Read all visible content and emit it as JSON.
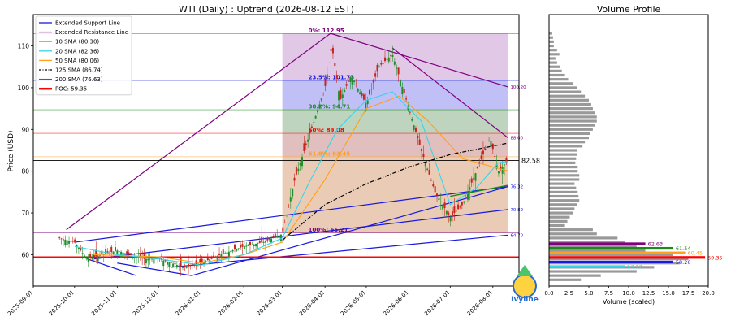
{
  "chart_data": [
    {
      "type": "line",
      "title": "WTI (Daily) : Uptrend (2026-08-12 EST)",
      "ylabel": "Price (USD)",
      "xlabel": "",
      "ylim": [
        52.5,
        117.5
      ],
      "xlim": [
        "2025-09-01",
        "2026-08-20"
      ],
      "grid": false,
      "legend_position": "top-left",
      "y_ticks": [
        60,
        70,
        80,
        90,
        100,
        110
      ],
      "x_ticks": [
        "2025-09-01",
        "2025-10-01",
        "2025-11-01",
        "2025-12-01",
        "2026-01-01",
        "2026-02-01",
        "2026-03-01",
        "2026-04-01",
        "2026-05-01",
        "2026-06-01",
        "2026-07-01",
        "2026-08-01"
      ],
      "last_price": 82.58,
      "legend": [
        {
          "label": "Extended Support Line",
          "color": "#1a1adc",
          "style": "solid"
        },
        {
          "label": "Extended Resistance Line",
          "color": "#800080",
          "style": "solid"
        },
        {
          "label": "10 SMA (80.30)",
          "color": "#ff7f50",
          "style": "solid"
        },
        {
          "label": "20 SMA (82.36)",
          "color": "#33d6e8",
          "style": "solid"
        },
        {
          "label": "50 SMA (80.06)",
          "color": "#ff9f1a",
          "style": "solid"
        },
        {
          "label": "125 SMA (86.74)",
          "color": "#000000",
          "style": "dashdot"
        },
        {
          "label": "200 SMA (76.63)",
          "color": "#1a8a1a",
          "style": "solid"
        },
        {
          "label": "POC: 59.35",
          "color": "#ff0000",
          "style": "thick"
        }
      ],
      "fib_levels": [
        {
          "label": "0%: 112.95",
          "value": 112.95,
          "color": "#800080"
        },
        {
          "label": "23.5%: 101.73",
          "value": 101.73,
          "color": "#1a1adc"
        },
        {
          "label": "38.2%: 94.71",
          "value": 94.71,
          "color": "#1a8a1a"
        },
        {
          "label": "50%: 89.08",
          "value": 89.08,
          "color": "#ff0000"
        },
        {
          "label": "61.8%: 83.45",
          "value": 83.45,
          "color": "#ff9f1a"
        },
        {
          "label": "100%: 65.21",
          "value": 65.21,
          "color": "#800080"
        }
      ],
      "right_labels": [
        {
          "text": "100.20",
          "value": 100.2,
          "color": "#800080"
        },
        {
          "text": "88.00",
          "value": 88.0,
          "color": "#800080"
        },
        {
          "text": "76.32",
          "value": 76.32,
          "color": "#1a1adc"
        },
        {
          "text": "70.82",
          "value": 70.82,
          "color": "#1a1adc"
        },
        {
          "text": "64.70",
          "value": 64.7,
          "color": "#1a1adc"
        }
      ],
      "price_series": {
        "name": "",
        "x": [
          "2025-09-20",
          "2025-10-01",
          "2025-10-10",
          "2025-10-20",
          "2025-11-01",
          "2025-11-10",
          "2025-11-20",
          "2025-12-01",
          "2025-12-10",
          "2025-12-20",
          "2026-01-01",
          "2026-01-15",
          "2026-02-01",
          "2026-02-15",
          "2026-03-01",
          "2026-03-10",
          "2026-03-20",
          "2026-04-01",
          "2026-04-06",
          "2026-04-12",
          "2026-04-20",
          "2026-05-01",
          "2026-05-10",
          "2026-05-20",
          "2026-06-01",
          "2026-06-10",
          "2026-06-20",
          "2026-07-01",
          "2026-07-10",
          "2026-07-20",
          "2026-07-30",
          "2026-08-05",
          "2026-08-12"
        ],
        "y": [
          64,
          63,
          59,
          60,
          61,
          60,
          59,
          59,
          58,
          57,
          58,
          60,
          62,
          63,
          65,
          78,
          88,
          100,
          110,
          97,
          103,
          96,
          105,
          108,
          95,
          85,
          75,
          69,
          72,
          80,
          88,
          80,
          82.58
        ]
      },
      "sma20": {
        "x": [
          "2025-10-01",
          "2025-11-01",
          "2025-12-01",
          "2026-01-01",
          "2026-02-01",
          "2026-03-01",
          "2026-03-20",
          "2026-04-10",
          "2026-05-01",
          "2026-05-20",
          "2026-06-10",
          "2026-07-01",
          "2026-07-20",
          "2026-08-05",
          "2026-08-12"
        ],
        "y": [
          62,
          60,
          59,
          57.5,
          60,
          64,
          77,
          90,
          97,
          99,
          92,
          72,
          76,
          82,
          82.36
        ]
      },
      "sma50": {
        "x": [
          "2025-10-15",
          "2025-12-01",
          "2026-01-01",
          "2026-02-01",
          "2026-03-01",
          "2026-04-01",
          "2026-05-01",
          "2026-05-25",
          "2026-06-15",
          "2026-07-10",
          "2026-08-12"
        ],
        "y": [
          60,
          59.5,
          58,
          60,
          63,
          78,
          95,
          98,
          92,
          83,
          80.06
        ]
      },
      "sma125": {
        "x": [
          "2026-03-01",
          "2026-04-01",
          "2026-05-01",
          "2026-06-01",
          "2026-07-01",
          "2026-08-12"
        ],
        "y": [
          63.5,
          72,
          77,
          81,
          84,
          86.74
        ]
      },
      "sma200": {
        "x": [
          "2026-07-01",
          "2026-08-12"
        ],
        "y": [
          74,
          76.63
        ]
      },
      "poc": 59.35
    },
    {
      "type": "bar",
      "orientation": "horizontal",
      "title": "Volume Profile",
      "xlabel": "Volume (scaled)",
      "ylabel": "",
      "xlim": [
        0,
        20
      ],
      "x_ticks": [
        0.0,
        2.5,
        5.0,
        7.5,
        10.0,
        12.5,
        15.0,
        17.5,
        20.0
      ],
      "bins": {
        "price": [
          113,
          112,
          111,
          110,
          109,
          108,
          107,
          106,
          105,
          104,
          103,
          102,
          101,
          100,
          99,
          98,
          97,
          96,
          95,
          94,
          93,
          92,
          91,
          90,
          89,
          88,
          87,
          86,
          85,
          84,
          83,
          82,
          81,
          80,
          79,
          78,
          77,
          76,
          75,
          74,
          73,
          72,
          71,
          70,
          69,
          68,
          67,
          66,
          65,
          64,
          63,
          62,
          61,
          60,
          59,
          58,
          57,
          56,
          55,
          54
        ],
        "volume": [
          0.4,
          0.5,
          0.6,
          0.6,
          1.0,
          1.3,
          0.8,
          1.0,
          1.4,
          1.6,
          2.0,
          2.4,
          3.0,
          3.5,
          4.0,
          4.5,
          5.0,
          5.3,
          5.5,
          5.8,
          6.0,
          6.0,
          5.8,
          5.5,
          5.2,
          5.0,
          4.5,
          4.2,
          3.5,
          3.5,
          3.4,
          3.3,
          3.6,
          3.6,
          3.8,
          3.8,
          3.2,
          3.4,
          3.6,
          3.7,
          3.8,
          3.5,
          3.2,
          3.0,
          2.6,
          2.3,
          2.0,
          5.5,
          6.0,
          8.6,
          9.5,
          11.0,
          12.1,
          15.6,
          17.5,
          16.4,
          13.2,
          11.0,
          6.5,
          4.0
        ],
        "color": "#999999"
      },
      "labeled_levels": [
        {
          "text": "62.63",
          "value": 62.63,
          "volume": 12.1,
          "color": "#800080"
        },
        {
          "text": "61.54",
          "value": 61.54,
          "volume": 15.6,
          "color": "#1a8a1a"
        },
        {
          "text": "60.45",
          "value": 60.45,
          "volume": 17.1,
          "color": "#ff9f1a"
        },
        {
          "text": "59.35",
          "value": 59.35,
          "volume": 19.6,
          "color": "#ff0000"
        },
        {
          "text": "58.26",
          "value": 58.26,
          "volume": 15.6,
          "color": "#1a1adc"
        },
        {
          "text": "57.17",
          "value": 57.17,
          "volume": 9.5,
          "color": "#33d6e8"
        }
      ]
    }
  ],
  "watermark": {
    "text": "Ivyline"
  }
}
